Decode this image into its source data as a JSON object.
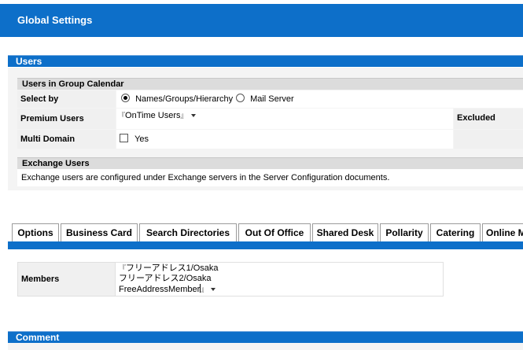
{
  "title": "Global Settings",
  "users_section": {
    "header": "Users",
    "group_calendar": {
      "header": "Users in Group Calendar",
      "select_by_label": "Select by",
      "options": [
        "Names/Groups/Hierarchy",
        "Mail Server"
      ],
      "selected_index": 0,
      "premium_label": "Premium Users",
      "premium_value": "OnTime Users",
      "excluded_label": "Excluded",
      "multi_domain_label": "Multi Domain",
      "multi_domain_option": "Yes",
      "multi_domain_checked": false
    },
    "exchange": {
      "header": "Exchange Users",
      "text": "Exchange users are configured under Exchange servers in the Server Configuration documents."
    }
  },
  "tabs": [
    {
      "label": "Options"
    },
    {
      "label": "Business Card"
    },
    {
      "label": "Search Directories"
    },
    {
      "label": "Out Of Office"
    },
    {
      "label": "Shared Desk"
    },
    {
      "label": "Pollarity"
    },
    {
      "label": "Catering"
    },
    {
      "label": "Online M"
    }
  ],
  "selected_tab": "Shared Desk",
  "members": {
    "label": "Members",
    "values": [
      "フリーアドレス1/Osaka",
      "フリーアドレス2/Osaka",
      "FreeAddressMember"
    ]
  },
  "comment": {
    "header": "Comment"
  },
  "colors": {
    "accent": "#0d6fc9",
    "group_header": "#dcdcdc",
    "label_bg": "#f0f0f0"
  }
}
